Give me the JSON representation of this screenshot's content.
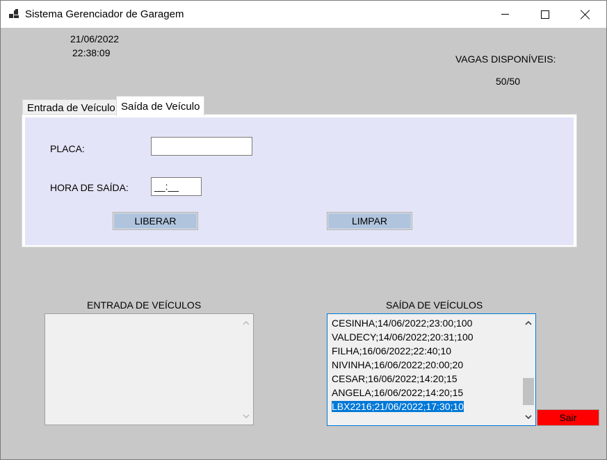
{
  "window": {
    "title": "Sistema Gerenciador de Garagem"
  },
  "header": {
    "date": "21/06/2022",
    "time": "22:38:09",
    "vagas_label": "VAGAS DISPONÍVEIS:",
    "vagas_value": "50/50"
  },
  "tabs": [
    {
      "label": "Entrada de Veículo",
      "active": false
    },
    {
      "label": "Saída de Veículo",
      "active": true
    }
  ],
  "form": {
    "placa_label": "PLACA:",
    "placa_value": "",
    "hora_label": "HORA DE SAÍDA:",
    "hora_value": "__:__",
    "liberar_label": "LIBERAR",
    "limpar_label": "LIMPAR"
  },
  "entrada": {
    "title": "ENTRADA DE VEÍCULOS",
    "items": []
  },
  "saida": {
    "title": "SAÍDA DE VEÍCULOS",
    "items": [
      "CESINHA;14/06/2022;23:00;100",
      "VALDECY;14/06/2022;20:31;100",
      "FILHA;16/06/2022;22:40;10",
      "NIVINHA;16/06/2022;20:00;20",
      "CESAR;16/06/2022;14:20;15",
      "ANGELA;16/06/2022;14:20;15",
      "LBX2216;21/06/2022;17:30;10"
    ],
    "selected_index": 6
  },
  "sair_label": "Sair",
  "colors": {
    "form_background": "#c8c8c8",
    "tabpage_background": "#e4e4f8",
    "button_background": "#b0c4de",
    "exit_button": "#ff0000",
    "selection": "#0078d7"
  }
}
